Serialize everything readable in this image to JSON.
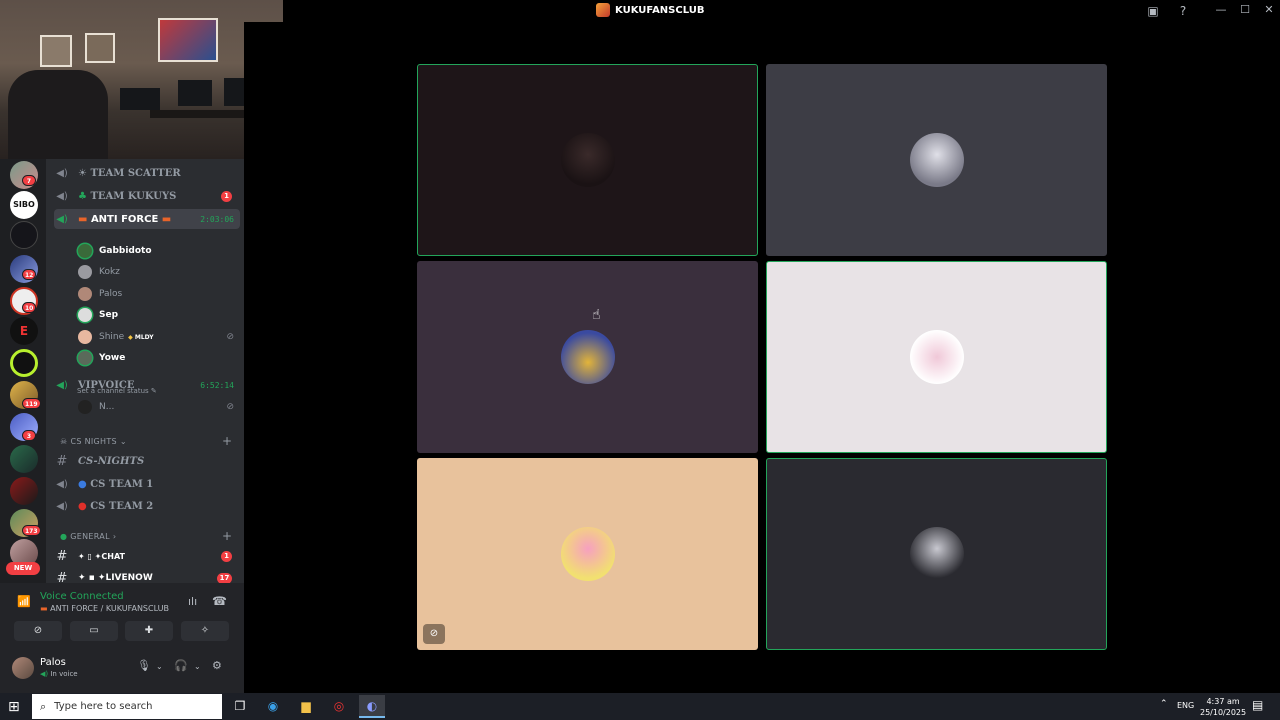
{
  "window": {
    "title": "KUKUFANSCLUB"
  },
  "servers": {
    "badges": [
      "7",
      "12",
      "10",
      "119",
      "3",
      "173"
    ],
    "new_label": "NEW",
    "sibo_label": "SIBO",
    "e_label": "E"
  },
  "channels": {
    "team_scatter": "TEAM SCATTER",
    "team_kukuys": "TEAM KUKUYS",
    "team_kukuys_badge": "1",
    "anti_force": "ANTI FORCE",
    "anti_force_timer": "2:03:06",
    "anti_force_status": "Set a channel status",
    "members": [
      {
        "name": "Gabbidoto"
      },
      {
        "name": "Kokz"
      },
      {
        "name": "Palos"
      },
      {
        "name": "Sep"
      },
      {
        "name": "Shine",
        "tag": "MLDY"
      },
      {
        "name": "Yowe"
      }
    ],
    "vipvoice": "VIPVOICE",
    "vipvoice_timer": "6:52:14",
    "vip_member": "N...",
    "cat_cs_nights": "CS NIGHTS",
    "cs_nights_text": "CS-NIGHTS",
    "cs_team_1": "CS TEAM 1",
    "cs_team_2": "CS TEAM 2",
    "cat_general": "GENERAL",
    "chat": "CHAT",
    "chat_badge": "1",
    "livenow": "LIVENOW",
    "livenow_badge": "17"
  },
  "voice_panel": {
    "status": "Voice Connected",
    "channel_path": "ANTI FORCE / KUKUFANSCLUB"
  },
  "user": {
    "name": "Palos",
    "status": "In voice"
  },
  "taskbar": {
    "search_placeholder": "Type here to search",
    "lang": "ENG",
    "time": "4:37 am",
    "date": "25/10/2025"
  },
  "colors": {
    "speaking": "#23a55a",
    "badge": "#f23f43",
    "tile_bg": [
      "#1e1518",
      "#3d3d45",
      "#3a2f3d",
      "#e8e3e6",
      "#e8c29c",
      "#2a2a30"
    ]
  }
}
